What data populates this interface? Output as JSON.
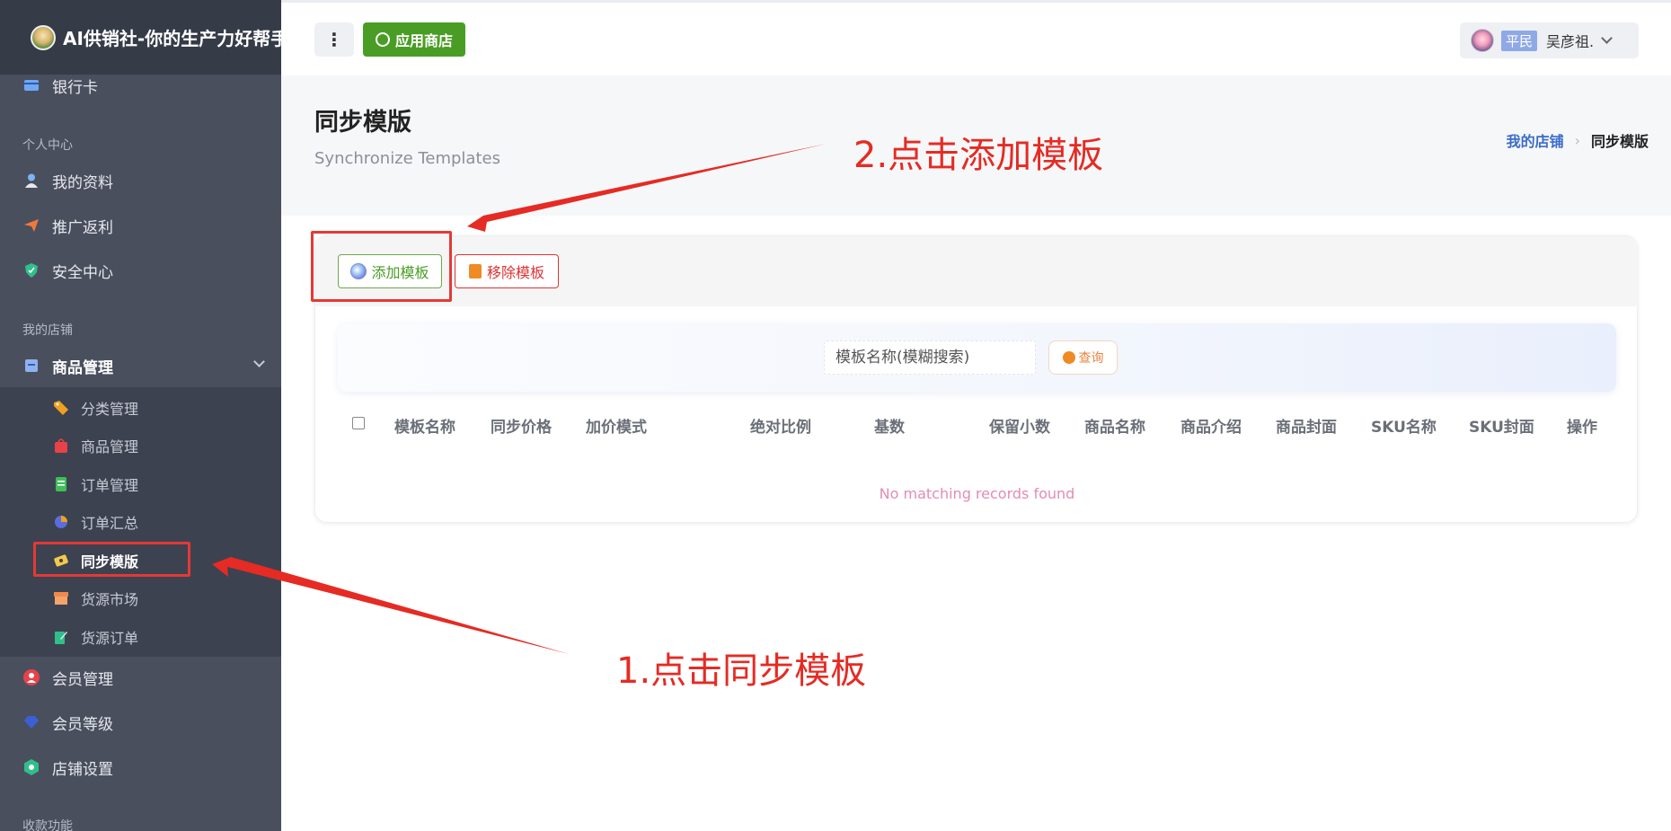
{
  "sidebar": {
    "brand_title": "AI供销社-你的生产力好帮手",
    "items_top": [
      {
        "label": "银行卡",
        "icon": "card-icon"
      }
    ],
    "section_personal": "个人中心",
    "items_personal": [
      {
        "label": "我的资料",
        "icon": "user-icon"
      },
      {
        "label": "推广返利",
        "icon": "paper-plane-icon"
      },
      {
        "label": "安全中心",
        "icon": "shield-icon"
      }
    ],
    "section_store": "我的店铺",
    "goods_group": {
      "label": "商品管理",
      "icon": "goods-icon"
    },
    "sub_items": [
      {
        "label": "分类管理",
        "icon": "tag-icon"
      },
      {
        "label": "商品管理",
        "icon": "bag-icon"
      },
      {
        "label": "订单管理",
        "icon": "order-icon"
      },
      {
        "label": "订单汇总",
        "icon": "pie-chart-icon"
      },
      {
        "label": "同步模版",
        "icon": "ticket-icon"
      },
      {
        "label": "货源市场",
        "icon": "store-icon"
      },
      {
        "label": "货源订单",
        "icon": "edit-icon"
      }
    ],
    "items_bottom": [
      {
        "label": "会员管理",
        "icon": "member-icon"
      },
      {
        "label": "会员等级",
        "icon": "diamond-icon"
      },
      {
        "label": "店铺设置",
        "icon": "hexagon-icon"
      }
    ],
    "section_pay": "收款功能"
  },
  "topbar": {
    "menu_glyph": "⋮",
    "store_label": "应用商店",
    "rank": "平民",
    "username": "吴彦祖."
  },
  "page": {
    "title": "同步模版",
    "subtitle": "Synchronize Templates",
    "breadcrumb_parent": "我的店铺",
    "breadcrumb_current": "同步模版"
  },
  "toolbar": {
    "add_label": "添加模板",
    "remove_label": "移除模板"
  },
  "search": {
    "placeholder": "模板名称(模糊搜索)",
    "query_label": "查询"
  },
  "table": {
    "columns": [
      "模板名称",
      "同步价格",
      "加价模式",
      "绝对比例",
      "基数",
      "保留小数",
      "商品名称",
      "商品介绍",
      "商品封面",
      "SKU名称",
      "SKU封面",
      "操作"
    ],
    "empty_text": "No matching records found"
  },
  "annotations": {
    "step1": "1.点击同步模板",
    "step2": "2.点击添加模板",
    "color": "#e52b23"
  },
  "colors": {
    "sidebar_bg": "#4a4f5e",
    "brand_bg": "#363b48",
    "accent_green": "#4a9d24",
    "danger_red": "#dd3333",
    "link_blue": "#3b6cc9"
  }
}
